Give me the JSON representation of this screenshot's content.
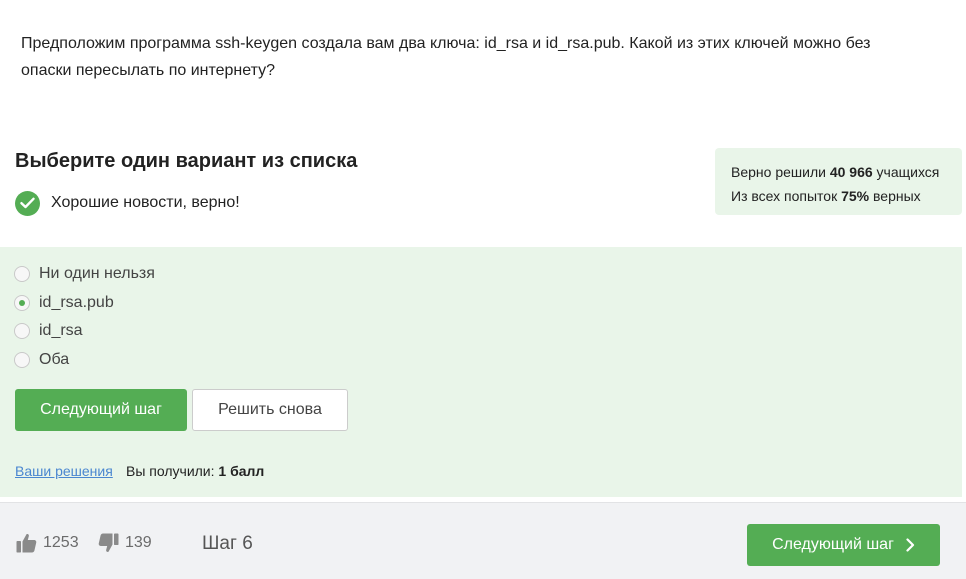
{
  "question": {
    "text": "Предположим программа ssh-keygen создала вам два ключа: id_rsa и id_rsa.pub. Какой из этих ключей можно без опаски пересылать по интернету?"
  },
  "quiz": {
    "header": "Выберите один вариант из списка",
    "feedback_message": "Хорошие новости, верно!",
    "feedback_icon": "check-circle-icon"
  },
  "stats": {
    "solved_prefix": "Верно решили",
    "solved_count": "40 966",
    "solved_suffix": "учащихся",
    "attempts_prefix": "Из всех попыток",
    "attempts_percent": "75%",
    "attempts_suffix": "верных"
  },
  "options": [
    {
      "label": "Ни один нельзя",
      "selected": false
    },
    {
      "label": "id_rsa.pub",
      "selected": true
    },
    {
      "label": "id_rsa",
      "selected": false
    },
    {
      "label": "Оба",
      "selected": false
    }
  ],
  "actions": {
    "next_label": "Следующий шаг",
    "retry_label": "Решить снова",
    "solutions_link": "Ваши решения",
    "score_prefix": "Вы получили:",
    "score_value": "1 балл"
  },
  "footer": {
    "likes": "1253",
    "dislikes": "139",
    "step_label": "Шаг 6",
    "next_label": "Следующий шаг"
  },
  "colors": {
    "accent": "#54ad54",
    "panel_bg": "#e9f5e9",
    "link": "#4a86d0",
    "footer_bg": "#f1f2f4"
  }
}
